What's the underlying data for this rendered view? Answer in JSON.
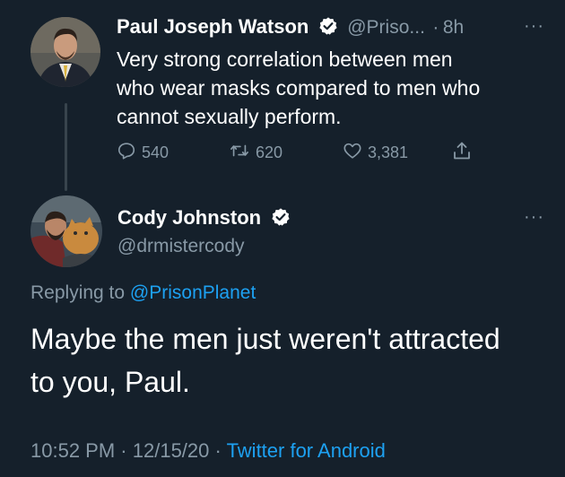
{
  "tweet1": {
    "display_name": "Paul Joseph Watson",
    "handle": "@Priso...",
    "time": "8h",
    "text_lines": [
      "Very strong correlation between men",
      "who wear masks compared to men who",
      "cannot sexually perform."
    ],
    "replies": "540",
    "retweets": "620",
    "likes": "3,381"
  },
  "tweet2": {
    "display_name": "Cody Johnston",
    "handle": "@drmistercody",
    "replying_label": "Replying to",
    "replying_handle": "@PrisonPlanet",
    "text_lines": [
      "Maybe the men just weren't attracted",
      "to you, Paul."
    ],
    "time": "10:52 PM",
    "date": "12/15/20",
    "source": "Twitter for Android"
  },
  "sep": "·",
  "more_glyph": "···",
  "colors": {
    "background": "#15202b",
    "text": "#ffffff",
    "secondary": "#8899a6",
    "accent": "#1da1f2"
  },
  "icons": [
    "verified-badge-icon",
    "reply-icon",
    "retweet-icon",
    "like-icon",
    "share-icon",
    "more-icon"
  ]
}
